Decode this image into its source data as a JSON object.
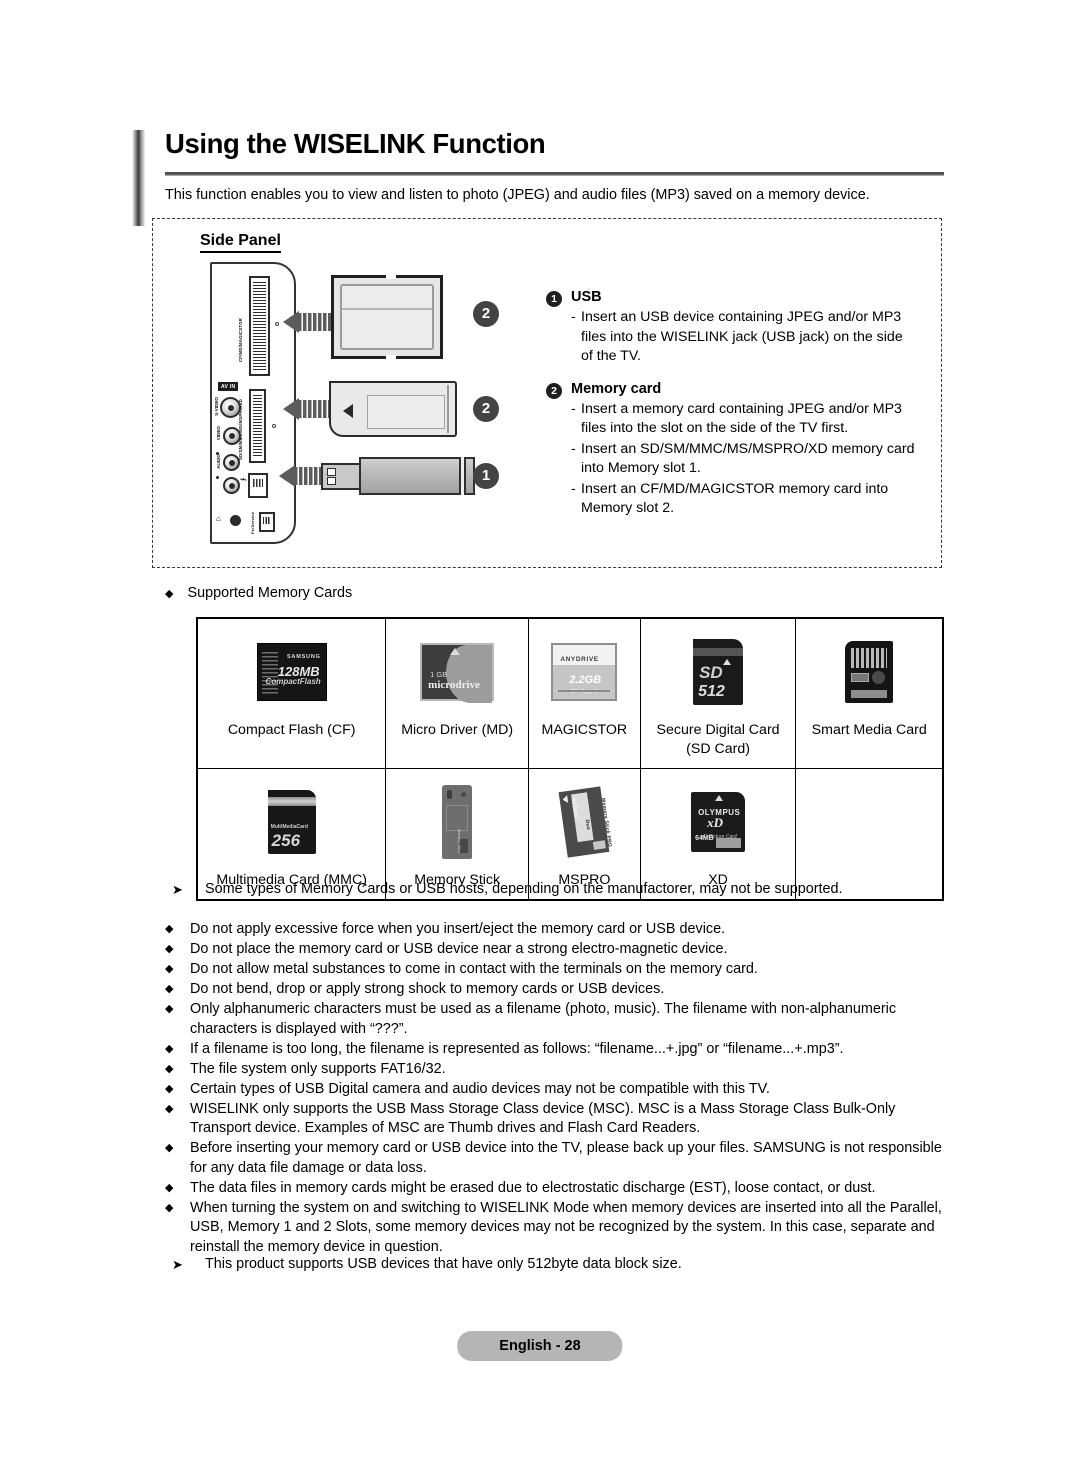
{
  "header": {
    "title": "Using the WISELINK Function",
    "intro": "This function enables you to view and listen to photo (JPEG) and audio files (MP3) saved on a memory device."
  },
  "side_panel": {
    "label": "Side Panel",
    "panel_labels": {
      "slot2_vertical": "CF/MD/MAGICSTOR",
      "slot1_vertical": "SD/SM/MMC/MS/MSPRO/XD",
      "av_in": "AV IN",
      "s_video": "S-VIDEO",
      "video": "VIDEO",
      "audio": "AUDIO",
      "headphone": "⌂",
      "service": "Pc/Service"
    },
    "badges": {
      "cf_slot": "2",
      "sd_slot": "2",
      "usb": "1"
    },
    "sections": [
      {
        "num": "1",
        "title": "USB",
        "items": [
          "Insert an USB device containing JPEG and/or MP3 files into the WISELINK jack (USB jack) on the side of the TV."
        ]
      },
      {
        "num": "2",
        "title": "Memory card",
        "items": [
          "Insert a memory card containing JPEG and/or MP3 files into the slot on the side of the TV first.",
          "Insert an SD/SM/MMC/MS/MSPRO/XD memory card into Memory slot 1.",
          "Insert an CF/MD/MAGICSTOR memory card into Memory slot 2."
        ]
      }
    ]
  },
  "supported": {
    "heading": "Supported Memory Cards",
    "bullet": "◆",
    "rows": [
      [
        {
          "art": "cf",
          "label": "Compact Flash (CF)",
          "label2": "",
          "capacity": "128MB",
          "brand": "SAMSUNG",
          "sub": "CompactFlash"
        },
        {
          "art": "md",
          "label": "Micro Driver (MD)",
          "label2": "",
          "capacity": "1 GB",
          "brand": "microdrive",
          "sub": ""
        },
        {
          "art": "mg",
          "label": "MAGICSTOR",
          "label2": "",
          "capacity": "2.2GB",
          "brand": "ANYDRIVE",
          "sub": "CF+ Type II"
        },
        {
          "art": "sd",
          "label": "Secure Digital Card",
          "label2": "(SD Card)",
          "capacity": "512",
          "brand": "SD",
          "sub": ""
        },
        {
          "art": "sm",
          "label": "Smart Media Card",
          "label2": "",
          "capacity": "",
          "brand": "SmartMedia",
          "sub": ""
        }
      ],
      [
        {
          "art": "mmc",
          "label": "Multimedia Card (MMC)",
          "label2": "",
          "capacity": "256",
          "brand": "MultiMediaCard",
          "sub": ""
        },
        {
          "art": "ms",
          "label": "Memory Stick",
          "label2": "",
          "capacity": "",
          "brand": "Memory Stick",
          "sub": ""
        },
        {
          "art": "mspro",
          "label": "MSPRO",
          "label2": "",
          "capacity": "512MB",
          "brand": "SanDisk",
          "sub": "Memory Stick PRO Duo"
        },
        {
          "art": "xd",
          "label": "XD",
          "label2": "",
          "capacity": "64MB",
          "brand": "OLYMPUS",
          "sub": "xD-Picture Card"
        },
        {
          "art": "",
          "label": "",
          "label2": "",
          "capacity": "",
          "brand": "",
          "sub": ""
        }
      ]
    ]
  },
  "note_top": {
    "glyph": "➤",
    "text": "Some types of Memory Cards or USB hosts, depending on the manufactorer,  may not be supported."
  },
  "notes": {
    "bullet": "◆",
    "items": [
      "Do not apply excessive force when you insert/eject the memory card or USB device.",
      "Do not place the memory card or USB device near a strong electro-magnetic device.",
      "Do not allow metal substances to come in contact with the terminals on the memory card.",
      "Do not bend, drop or apply strong shock to memory cards or USB devices.",
      "Only alphanumeric characters must be used as a filename (photo, music). The filename with non-alphanumeric characters is displayed with “???”.",
      "If a filename is too long, the filename is represented as follows: “filename...+.jpg” or “filename...+.mp3”.",
      "The file system only supports FAT16/32.",
      "Certain types of USB Digital camera and audio devices may not be compatible with this TV.",
      "WISELINK only supports the USB Mass Storage Class device (MSC). MSC is a Mass Storage Class Bulk-Only Transport device. Examples of MSC are Thumb drives and Flash Card Readers.",
      "Before inserting your memory card or USB device into the TV, please back up your files. SAMSUNG is not responsible for any data file damage or data loss.",
      "The data files in memory cards might be erased due to electrostatic discharge (EST), loose contact, or dust.",
      "When turning the system on and switching to WISELINK Mode when memory devices are inserted into all the Parallel, USB, Memory 1 and 2 Slots, some memory devices may not be recognized by the system. In this case, separate and reinstall the memory device in question."
    ]
  },
  "note_bottom": {
    "glyph": "➤",
    "text": "This product supports USB devices that have only 512byte data block size."
  },
  "footer": {
    "page_label": "English - 28"
  },
  "colors": {
    "badge_bg": "#434343",
    "footer_bg": "#b5b5b5",
    "rule": "#4d4d4d"
  }
}
